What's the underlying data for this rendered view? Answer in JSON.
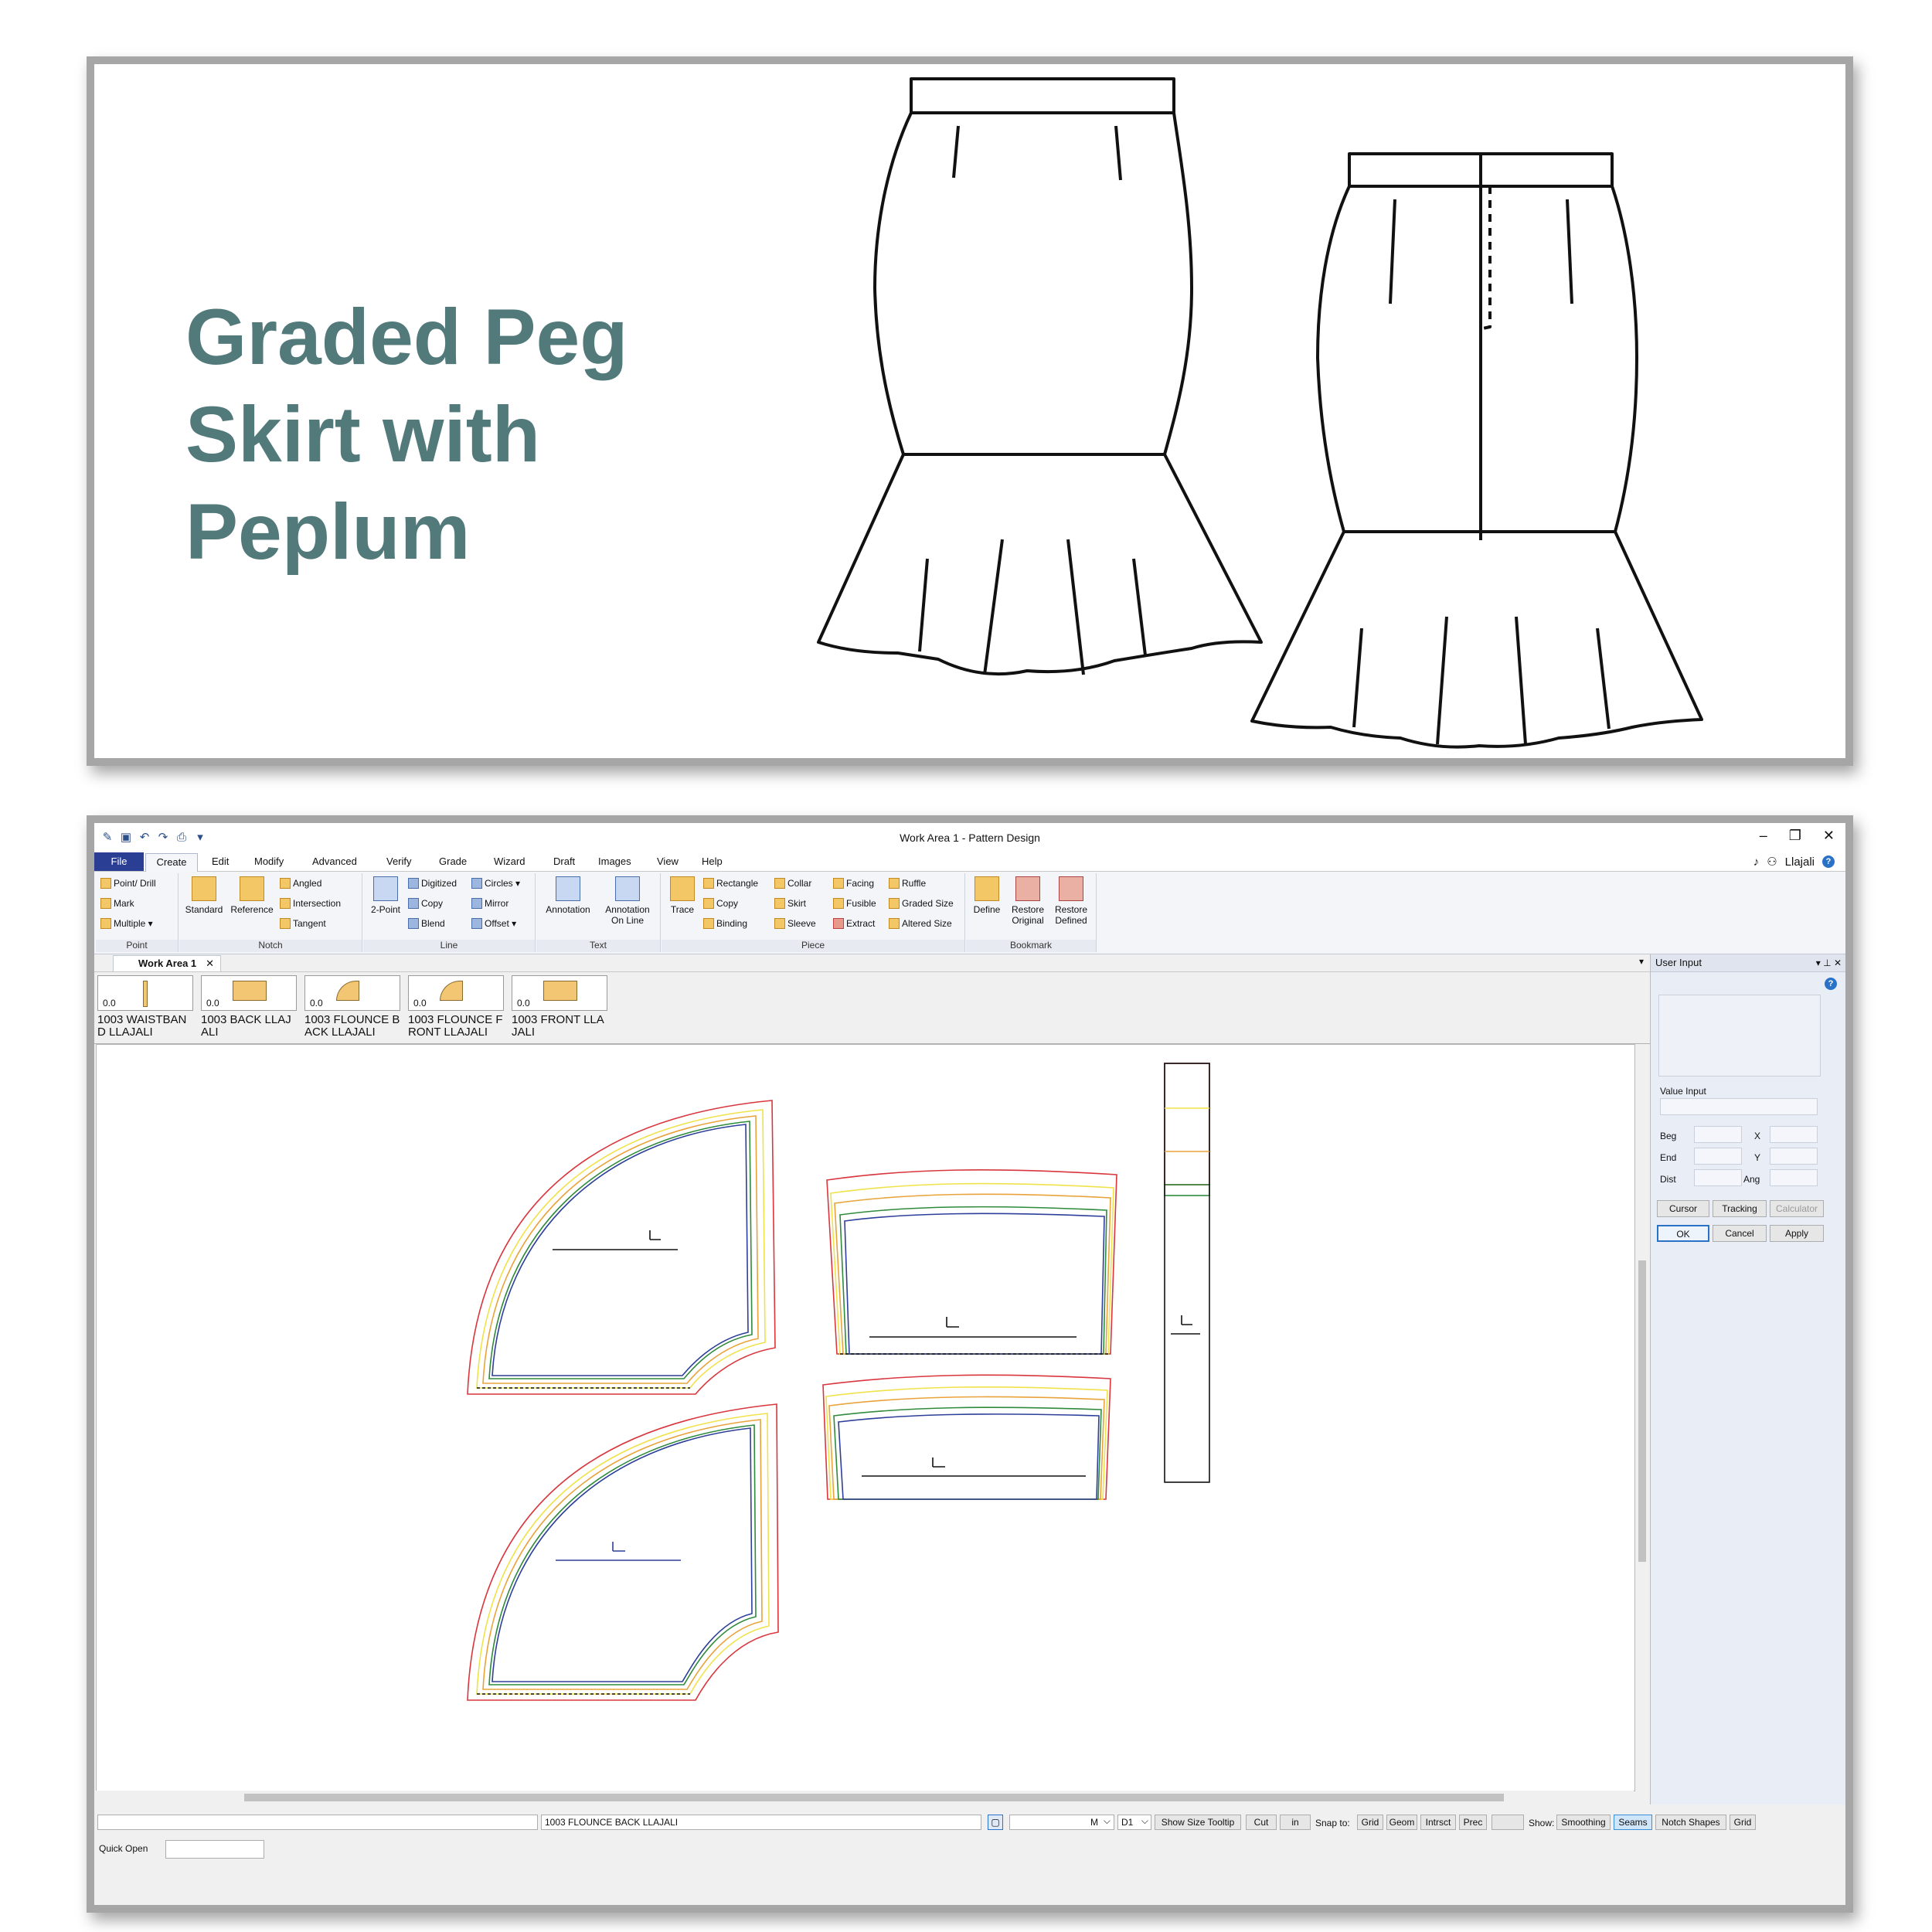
{
  "headline": {
    "line1": "Graded Peg",
    "line2": "Skirt with",
    "line3": "Peplum"
  },
  "colors": {
    "headline": "#527a7b",
    "file_tab": "#2a3f93",
    "grade_red": "#d9363e",
    "grade_yellow": "#f0e24a",
    "grade_orange": "#e8a33a",
    "grade_green": "#2f8a3c",
    "grade_blue": "#2d3f9a"
  },
  "window": {
    "title": "Work Area 1 - Pattern Design",
    "controls": [
      "–",
      "❐",
      "✕"
    ]
  },
  "menu": {
    "file": "File",
    "create": "Create",
    "items": [
      "Edit",
      "Modify",
      "Advanced",
      "Verify",
      "Grade",
      "Wizard",
      "Draft",
      "Images",
      "View",
      "Help"
    ],
    "user": "Llajali",
    "help": "?"
  },
  "ribbon": {
    "point": {
      "label": "Point",
      "buttons": [
        "Point/ Drill",
        "Mark",
        "Multiple ▾"
      ]
    },
    "notch": {
      "label": "Notch",
      "big": [
        "Standard",
        "Reference"
      ],
      "buttons": [
        "Angled",
        "Intersection",
        "Tangent"
      ]
    },
    "line": {
      "label": "Line",
      "big": "2-Point",
      "buttons": [
        "Digitized",
        "Copy",
        "Blend",
        "Circles ▾",
        "Mirror",
        "Offset ▾"
      ]
    },
    "text": {
      "label": "Text",
      "big": [
        "Annotation",
        "Annotation On Line"
      ]
    },
    "piece": {
      "label": "Piece",
      "big": "Trace",
      "buttons": [
        "Rectangle",
        "Copy",
        "Binding",
        "Collar",
        "Skirt",
        "Sleeve",
        "Facing",
        "Fusible",
        "Extract",
        "Ruffle",
        "Graded Size",
        "Altered Size"
      ]
    },
    "bookmark": {
      "label": "Bookmark",
      "big": [
        "Define",
        "Restore Original",
        "Restore Defined"
      ]
    }
  },
  "doc_tab": {
    "label": "Work Area 1",
    "close": "✕"
  },
  "pieces": [
    {
      "value": "0.0",
      "label": "1003  WAISTBAND LLAJALI"
    },
    {
      "value": "0.0",
      "label": "1003 BACK LLAJALI"
    },
    {
      "value": "0.0",
      "label": "1003 FLOUNCE BACK LLAJALI"
    },
    {
      "value": "0.0",
      "label": "1003 FLOUNCE FRONT LLAJALI"
    },
    {
      "value": "0.0",
      "label": "1003 FRONT LLAJALI"
    }
  ],
  "user_input": {
    "title": "User Input",
    "value_input": "Value Input",
    "beg": "Beg",
    "end": "End",
    "dist": "Dist",
    "x": "X",
    "y": "Y",
    "ang": "Ang",
    "cursor": "Cursor",
    "tracking": "Tracking",
    "calculator": "Calculator",
    "ok": "OK",
    "cancel": "Cancel",
    "apply": "Apply"
  },
  "statusbar": {
    "current_piece": "1003 FLOUNCE BACK LLAJALI",
    "size": "M",
    "size_chevron": "⌵",
    "d1": "D1",
    "show_size_tooltip": "Show Size Tooltip",
    "cut": "Cut",
    "unit": "in",
    "snap_label": "Snap to:",
    "snap": [
      "Grid",
      "Geom",
      "Intrsct",
      "Prec"
    ],
    "show_label": "Show:",
    "show": [
      "Smoothing",
      "Seams",
      "Notch Shapes",
      "Grid"
    ],
    "active_show": "Seams",
    "quick_open": "Quick Open"
  }
}
